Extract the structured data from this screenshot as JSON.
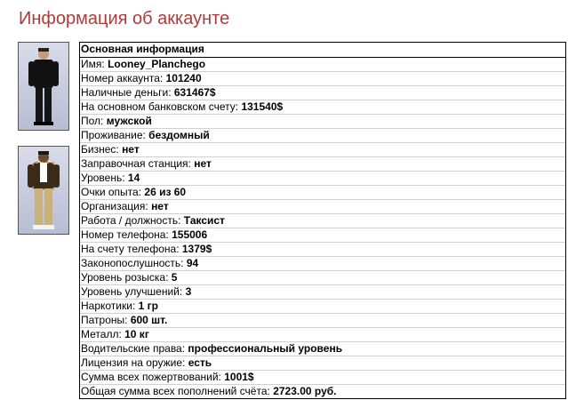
{
  "page": {
    "title": "Информация об аккаунте"
  },
  "avatars": [
    {
      "name": "skin-suit-avatar"
    },
    {
      "name": "skin-casual-avatar"
    }
  ],
  "info": {
    "header": "Основная информация",
    "rows": [
      {
        "label": "Имя:",
        "value": "Looney_Planchego"
      },
      {
        "label": "Номер аккаунта:",
        "value": "101240"
      },
      {
        "label": "Наличные деньги:",
        "value": "631467$"
      },
      {
        "label": "На основном банковском счету:",
        "value": "131540$"
      },
      {
        "label": "Пол:",
        "value": "мужской"
      },
      {
        "label": "Проживание:",
        "value": "бездомный"
      },
      {
        "label": "Бизнес:",
        "value": "нет"
      },
      {
        "label": "Заправочная станция:",
        "value": "нет"
      },
      {
        "label": "Уровень:",
        "value": "14"
      },
      {
        "label": "Очки опыта:",
        "value": "26 из 60"
      },
      {
        "label": "Организация:",
        "value": "нет"
      },
      {
        "label": "Работа / должность:",
        "value": "Таксист"
      },
      {
        "label": "Номер телефона:",
        "value": "155006"
      },
      {
        "label": "На счету телефона:",
        "value": "1379$"
      },
      {
        "label": "Законопослушность:",
        "value": "94"
      },
      {
        "label": "Уровень розыска:",
        "value": "5"
      },
      {
        "label": "Уровень улучшений:",
        "value": "3"
      },
      {
        "label": "Наркотики:",
        "value": "1 гр"
      },
      {
        "label": "Патроны:",
        "value": "600 шт."
      },
      {
        "label": "Металл:",
        "value": "10 кг"
      },
      {
        "label": "Водительские права:",
        "value": "профессиональный уровень"
      },
      {
        "label": "Лицензия на оружие:",
        "value": "есть"
      },
      {
        "label": "Сумма всех пожертвований:",
        "value": "1001$"
      },
      {
        "label": "Общая сумма всех пополнений счёта:",
        "value": "2723.00 руб."
      }
    ]
  }
}
